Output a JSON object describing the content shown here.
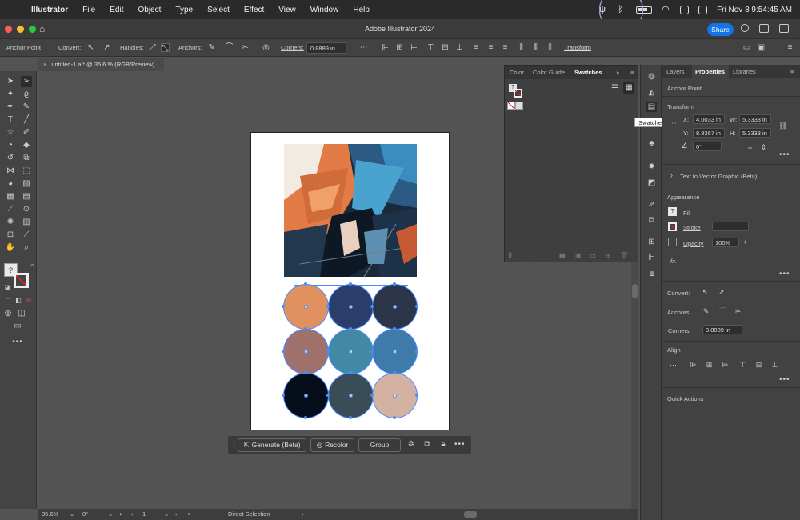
{
  "menubar": {
    "app_name": "Illustrator",
    "items": [
      "File",
      "Edit",
      "Object",
      "Type",
      "Select",
      "Effect",
      "View",
      "Window",
      "Help"
    ],
    "clock": "Fri Nov 8  9:54:45 AM"
  },
  "titlebar": {
    "title": "Adobe Illustrator 2024",
    "share_label": "Share"
  },
  "controlbar": {
    "mode_label": "Anchor Point",
    "convert_label": "Convert:",
    "handles_label": "Handles:",
    "anchors_label": "Anchors:",
    "corners_label": "Corners:",
    "corners_value": "0.8889 in",
    "transform_label": "Transform"
  },
  "document": {
    "tab_title": "untitled-1.ai* @ 35.6 % (RGB/Preview)"
  },
  "swatches_panel": {
    "tabs": [
      "Color",
      "Color Guide",
      "Swatches"
    ],
    "active_tab": "Swatches"
  },
  "tooltip": {
    "text": "Swatches"
  },
  "properties_panel": {
    "tabs": [
      "Layers",
      "Properties",
      "Libraries"
    ],
    "active_tab": "Properties",
    "selection_type": "Anchor Point",
    "transform": {
      "heading": "Transform",
      "x_label": "X:",
      "x_value": "4.0033 in",
      "y_label": "Y:",
      "y_value": "8.8367 in",
      "w_label": "W:",
      "w_value": "5.3333 in",
      "h_label": "H:",
      "h_value": "5.3333 in",
      "angle_value": "0°"
    },
    "text_to_vector": "Text to Vector Graphic (Beta)",
    "appearance": {
      "heading": "Appearance",
      "fill_label": "Fill",
      "stroke_label": "Stroke",
      "opacity_label": "Opacity",
      "opacity_value": "100%",
      "fx_label": "fx."
    },
    "convert_label": "Convert:",
    "anchors_label": "Anchors:",
    "corners_label": "Corners:",
    "corners_value": "0.8889 in",
    "align_heading": "Align",
    "quick_actions_heading": "Quick Actions"
  },
  "taskbar": {
    "generate_label": "Generate (Beta)",
    "recolor_label": "Recolor",
    "group_label": "Group"
  },
  "statusbar": {
    "zoom": "35.6%",
    "rotation": "0°",
    "artboard_number": "1",
    "tool_name": "Direct Selection"
  },
  "artboard": {
    "circle_colors": [
      "#e0915f",
      "#2b3d6b",
      "#2c3547",
      "#a0706a",
      "#4189a5",
      "#3e7aaa",
      "#060d1a",
      "#3a4c58",
      "#d4b2a2"
    ]
  },
  "colors": {
    "accent": "#1473e6",
    "selection": "#4a8bff"
  }
}
